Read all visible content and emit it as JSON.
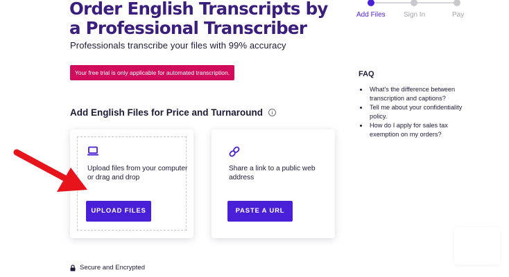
{
  "header": {
    "title": "Order English Transcripts by a Professional Transcriber",
    "subtitle": "Professionals transcribe your files with 99% accuracy"
  },
  "banner": {
    "text": "Your free trial is only applicable for automated transcription.",
    "color": "#d10c5c"
  },
  "stepper": {
    "steps": [
      {
        "label": "Add Files",
        "active": true
      },
      {
        "label": "Sign In",
        "active": false
      },
      {
        "label": "Pay",
        "active": false
      }
    ]
  },
  "faq": {
    "title": "FAQ",
    "items": [
      "What's the difference between transcription and captions?",
      "Tell me about your confidentiality policy.",
      "How do I apply for sales tax exemption on my orders?"
    ]
  },
  "section": {
    "title": "Add English Files for Price and Turnaround",
    "info_icon": "info-circle-icon"
  },
  "upload_card": {
    "icon": "laptop-icon",
    "text": "Upload files from your computer or drag and drop",
    "button_label": "UPLOAD FILES"
  },
  "url_card": {
    "icon": "link-icon",
    "text": "Share a link to a public web address",
    "button_label": "PASTE A URL"
  },
  "footer": {
    "secure_text": "Secure and Encrypted",
    "icon": "lock-icon"
  },
  "colors": {
    "accent": "#4a1fd8",
    "headline": "#3a1d7c",
    "banner": "#d10c5c",
    "annotation_arrow": "#e8141c"
  }
}
